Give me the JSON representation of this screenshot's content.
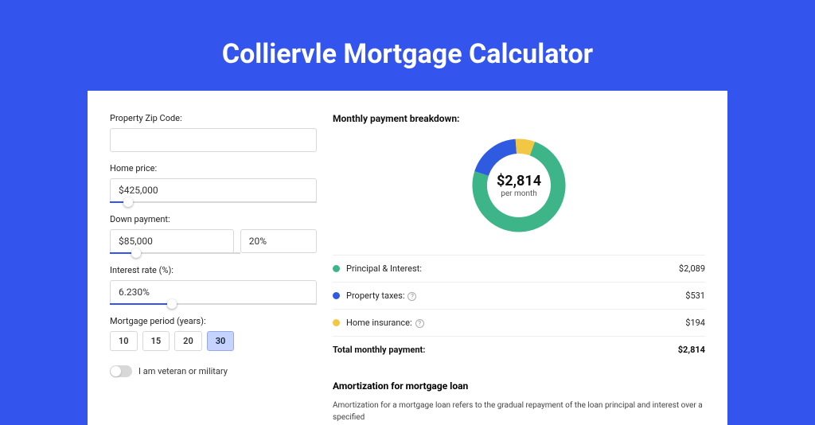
{
  "title": "Colliervle Mortgage Calculator",
  "form": {
    "zip_label": "Property Zip Code:",
    "zip_value": "",
    "home_price_label": "Home price:",
    "home_price_value": "$425,000",
    "home_price_slider_pct": 9,
    "down_payment_label": "Down payment:",
    "down_payment_value": "$85,000",
    "down_payment_pct_value": "20%",
    "down_payment_slider_pct": 20,
    "interest_label": "Interest rate (%):",
    "interest_value": "6.230%",
    "interest_slider_pct": 30,
    "period_label": "Mortgage period (years):",
    "periods": [
      "10",
      "15",
      "20",
      "30"
    ],
    "period_selected_index": 3,
    "veteran_label": "I am veteran or military",
    "veteran_on": false
  },
  "breakdown": {
    "title": "Monthly payment breakdown:",
    "center_amount": "$2,814",
    "center_sub": "per month",
    "items": [
      {
        "label": "Principal & Interest:",
        "value": "$2,089",
        "color": "#3eb489",
        "has_info": false
      },
      {
        "label": "Property taxes:",
        "value": "$531",
        "color": "#2e5be0",
        "has_info": true
      },
      {
        "label": "Home insurance:",
        "value": "$194",
        "color": "#f2c744",
        "has_info": true
      }
    ],
    "total_label": "Total monthly payment:",
    "total_value": "$2,814"
  },
  "chart_data": {
    "type": "pie",
    "title": "Monthly payment breakdown",
    "series": [
      {
        "name": "Principal & Interest",
        "value": 2089,
        "color": "#3eb489"
      },
      {
        "name": "Property taxes",
        "value": 531,
        "color": "#2e5be0"
      },
      {
        "name": "Home insurance",
        "value": 194,
        "color": "#f2c744"
      }
    ],
    "total": 2814,
    "center_label": "$2,814 per month"
  },
  "amort": {
    "title": "Amortization for mortgage loan",
    "text": "Amortization for a mortgage loan refers to the gradual repayment of the loan principal and interest over a specified"
  }
}
